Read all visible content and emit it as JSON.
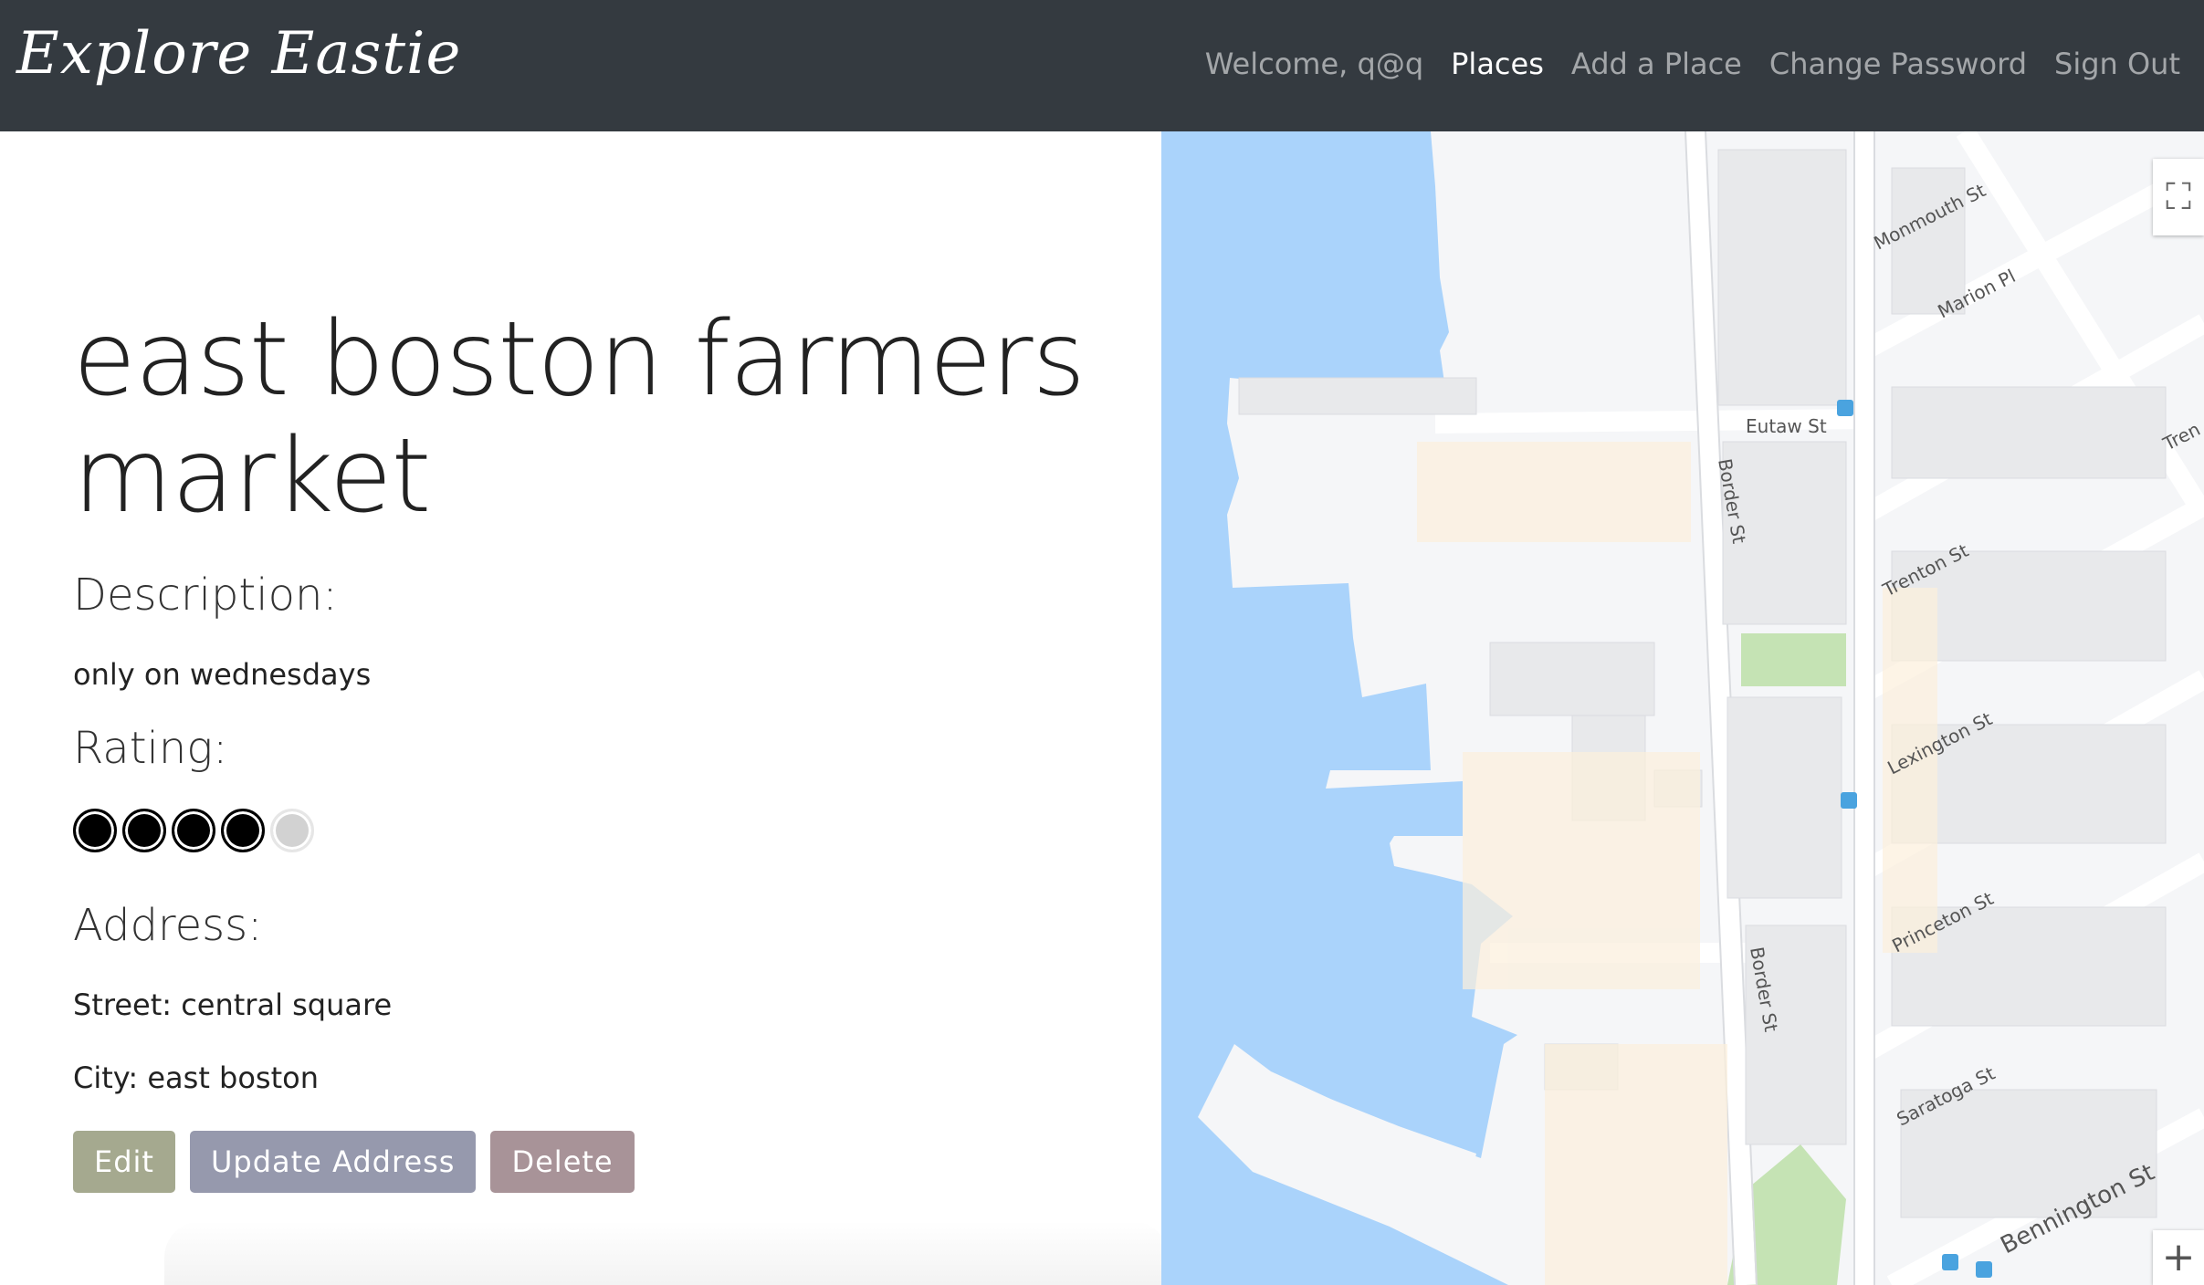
{
  "header": {
    "brand": "Explore Eastie",
    "nav": [
      {
        "label": "Welcome, q@q",
        "active": false
      },
      {
        "label": "Places",
        "active": true
      },
      {
        "label": "Add a Place",
        "active": false
      },
      {
        "label": "Change Password",
        "active": false
      },
      {
        "label": "Sign Out",
        "active": false
      }
    ]
  },
  "place": {
    "title": "east boston farmers market",
    "description_heading": "Description:",
    "description": "only on wednesdays",
    "rating_heading": "Rating:",
    "rating": {
      "value": 4,
      "max": 5
    },
    "address_heading": "Address:",
    "street": "Street: central square",
    "city": "City: east boston"
  },
  "actions": {
    "edit": "Edit",
    "update_address": "Update Address",
    "delete": "Delete"
  },
  "map": {
    "streets": [
      "Monmouth St",
      "Marion Pl",
      "Eutaw St",
      "Border St",
      "Trenton St",
      "Lexington St",
      "Princeton St",
      "Border St",
      "Saratoga St",
      "Bennington St",
      "Tren"
    ],
    "fullscreen_icon": "fullscreen-icon",
    "zoom_in_label": "+",
    "water_color": "#aad3fb",
    "land_color": "#f5f6f8",
    "park_color": "#c5e3b4"
  }
}
